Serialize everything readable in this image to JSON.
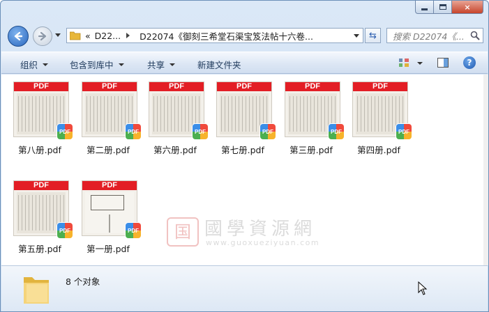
{
  "window": {
    "caption_buttons": {
      "minimize": "minimize",
      "maximize": "maximize",
      "close": "×"
    }
  },
  "address_bar": {
    "overflow_chevron": "«",
    "segments": [
      "D22...",
      "D22074《御刻三希堂石渠宝笈法帖十六卷..."
    ]
  },
  "search": {
    "placeholder": "搜索 D22074《..."
  },
  "toolbar": {
    "organize": "组织",
    "include_in_library": "包含到库中",
    "share": "共享",
    "new_folder": "新建文件夹"
  },
  "files": [
    {
      "name": "第八册.pdf",
      "thumb_label": "PDF",
      "badge": "PDF"
    },
    {
      "name": "第二册.pdf",
      "thumb_label": "PDF",
      "badge": "PDF"
    },
    {
      "name": "第六册.pdf",
      "thumb_label": "PDF",
      "badge": "PDF"
    },
    {
      "name": "第七册.pdf",
      "thumb_label": "PDF",
      "badge": "PDF"
    },
    {
      "name": "第三册.pdf",
      "thumb_label": "PDF",
      "badge": "PDF"
    },
    {
      "name": "第四册.pdf",
      "thumb_label": "PDF",
      "badge": "PDF"
    },
    {
      "name": "第五册.pdf",
      "thumb_label": "PDF",
      "badge": "PDF"
    },
    {
      "name": "第一册.pdf",
      "thumb_label": "PDF",
      "badge": "PDF"
    }
  ],
  "watermark": {
    "seal": "国",
    "title": "國學資源網",
    "url": "www.guoxueziyuan.com"
  },
  "status": {
    "item_count": "8 个对象"
  },
  "colors": {
    "pdf_band": "#e31e25",
    "chrome": "#c9dcf1"
  }
}
